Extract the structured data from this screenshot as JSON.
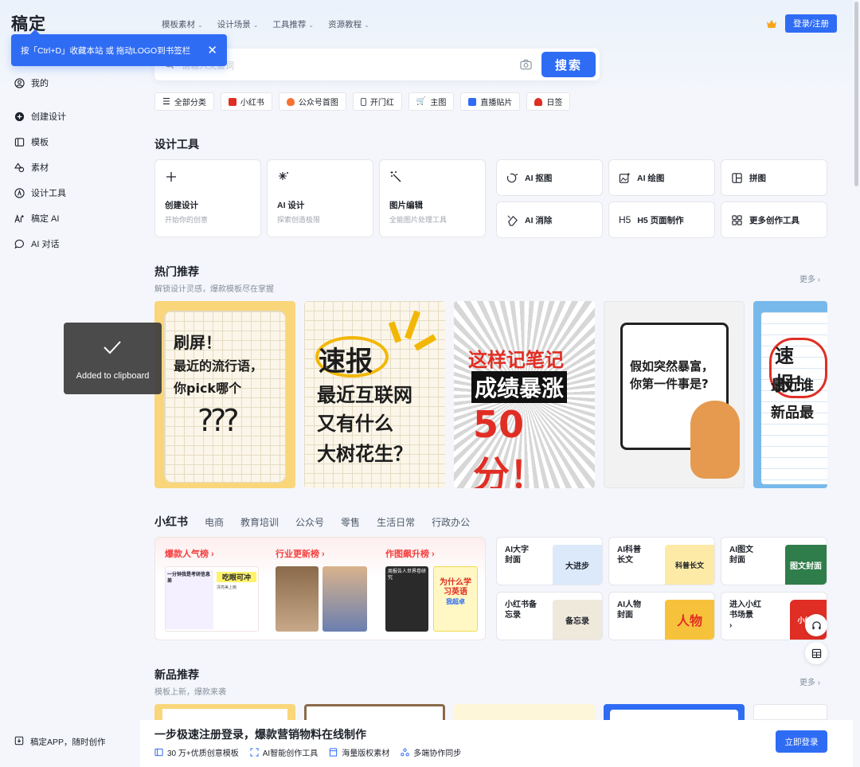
{
  "logo": "稿定",
  "bookmark_tip": "按「Ctrl+D」收藏本站 或 拖动LOGO到书签栏",
  "sidebar": {
    "items": [
      {
        "label": "我的",
        "icon": "user-icon"
      },
      {
        "label": "创建设计",
        "icon": "plus-circle-icon"
      },
      {
        "label": "模板",
        "icon": "template-icon"
      },
      {
        "label": "素材",
        "icon": "shapes-icon"
      },
      {
        "label": "设计工具",
        "icon": "compass-icon"
      },
      {
        "label": "稿定 AI",
        "icon": "ai-icon"
      },
      {
        "label": "AI 对话",
        "icon": "chat-icon"
      }
    ],
    "app_link": "稿定APP，随时创作"
  },
  "topmenu": [
    "模板素材",
    "设计场景",
    "工具推荐",
    "资源教程"
  ],
  "login_label": "登录/注册",
  "search": {
    "placeholder": "请输入关键词",
    "button": "搜索"
  },
  "chips": [
    {
      "label": "全部分类",
      "color": "#4e5969"
    },
    {
      "label": "小红书",
      "color": "#e02e24"
    },
    {
      "label": "公众号首图",
      "color": "#f77234"
    },
    {
      "label": "开门红",
      "color": "#4e5969"
    },
    {
      "label": "主图",
      "color": "#4e5969"
    },
    {
      "label": "直播贴片",
      "color": "#2f6cf4"
    },
    {
      "label": "日签",
      "color": "#e02e24"
    }
  ],
  "design_tools": {
    "title": "设计工具",
    "big": [
      {
        "title": "创建设计",
        "desc": "开始你的创意"
      },
      {
        "title": "AI 设计",
        "desc": "探索创造极限"
      },
      {
        "title": "图片编辑",
        "desc": "全能图片处理工具"
      }
    ],
    "small": [
      "AI 抠图",
      "AI 绘图",
      "拼图",
      "AI 消除",
      "H5 页面制作",
      "更多创作工具"
    ]
  },
  "hot": {
    "title": "热门推荐",
    "subtitle": "解锁设计灵感，爆款模板尽在掌握",
    "more": "更多",
    "cards": [
      {
        "lines": [
          "刷屏！",
          "最近的流行语，",
          "你pick哪个",
          "???"
        ]
      },
      {
        "lines": [
          "速报",
          "最近互联网",
          "又有什么",
          "大树花生？"
        ]
      },
      {
        "lines": [
          "这样记笔记",
          "成绩暴涨",
          "50分！"
        ]
      },
      {
        "lines": [
          "假如突然暴富，",
          "你第一件事是?"
        ]
      },
      {
        "lines": [
          "速报！",
          "最近谁",
          "新品最"
        ]
      }
    ]
  },
  "toast": "Added to clipboard",
  "xhs": {
    "tabs": [
      "小红书",
      "电商",
      "教育培训",
      "公众号",
      "零售",
      "生活日常",
      "行政办公"
    ],
    "ranks": [
      {
        "title": "爆款人气榜 ›",
        "thumb_texts": [
          "一分钟我是考研信息差",
          "吃眼可冲",
          "漂亮美上瘾"
        ]
      },
      {
        "title": "行业更新榜 ›",
        "thumb_texts": []
      },
      {
        "title": "作图飙升榜 ›",
        "thumb_texts": [
          "周报告人世界卷研究",
          "为什么学习英语",
          "我超卓"
        ]
      }
    ],
    "cards": [
      {
        "title": "AI大字\n封面",
        "thumb": "大进步"
      },
      {
        "title": "AI科普\n长文",
        "thumb": "科普长文"
      },
      {
        "title": "AI图文\n封面",
        "thumb": "图文封面"
      },
      {
        "title": "小红书备\n忘录",
        "thumb": "备忘录"
      },
      {
        "title": "AI人物\n封面",
        "thumb": "人物"
      },
      {
        "title": "进入小红\n书场景\n›",
        "thumb": "小红书"
      }
    ]
  },
  "new": {
    "title": "新品推荐",
    "subtitle": "模板上新，爆款来袭",
    "more": "更多"
  },
  "bottom": {
    "title": "一步极速注册登录，爆款营销物料在线制作",
    "features": [
      "30 万+优质创意模板",
      "AI智能创作工具",
      "海量版权素材",
      "多端协作同步"
    ],
    "button": "立即登录"
  }
}
